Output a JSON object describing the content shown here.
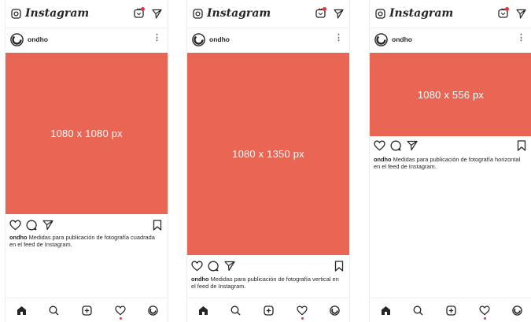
{
  "app": {
    "name": "Instagram"
  },
  "phones": [
    {
      "username": "ondho",
      "media_label": "1080 x 1080 px",
      "caption_user": "ondho",
      "caption_text": " Medidas para publicación de fotografía cuadrada en el feed de Instagram."
    },
    {
      "username": "ondho",
      "media_label": "1080 x 1350 px",
      "caption_user": "ondho",
      "caption_text": " Medidas para publicación de fotografía vertical en el feed de Instagram."
    },
    {
      "username": "ondho",
      "media_label": "1080 x 556 px",
      "caption_user": "ondho",
      "caption_text": " Medidas para publicación de fotografía horizontal en el feed de Instagram."
    }
  ],
  "icons": {
    "top": [
      "camera-icon",
      "igtv-icon",
      "direct-send-icon"
    ],
    "post": [
      "more-options-icon"
    ],
    "actions": [
      "like-heart-icon",
      "comment-icon",
      "share-icon",
      "bookmark-icon"
    ],
    "nav": [
      "home-icon",
      "search-icon",
      "new-post-icon",
      "activity-heart-icon",
      "profile-icon"
    ]
  },
  "colors": {
    "media_placeholder": "#e96655",
    "notification": "#e8323b",
    "text": "#262626"
  }
}
